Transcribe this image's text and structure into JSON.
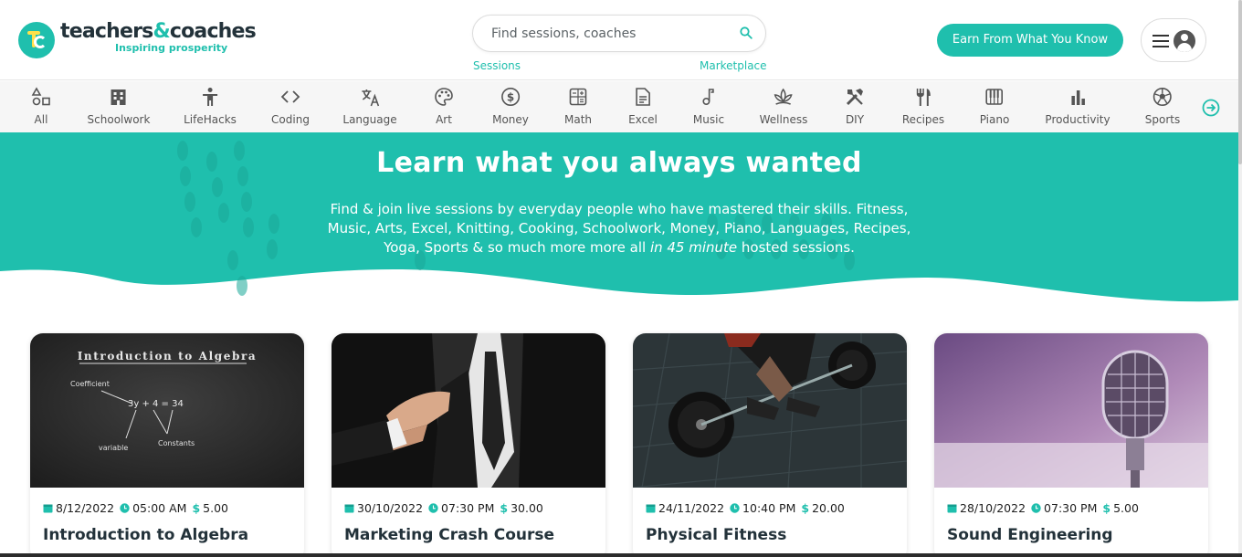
{
  "brand": {
    "name_part1": "teachers",
    "name_amp": "&",
    "name_part2": "coaches",
    "tagline": "Inspiring prosperity",
    "accent": "#1fbfad"
  },
  "search": {
    "placeholder": "Find sessions, coaches",
    "icon": "search-icon",
    "links": [
      "Sessions",
      "Marketplace"
    ]
  },
  "header": {
    "cta_label": "Earn From What You Know",
    "menu_icon": "hamburger-icon",
    "avatar_icon": "user-avatar-icon"
  },
  "categories": [
    {
      "label": "All",
      "icon": "shapes-icon"
    },
    {
      "label": "Schoolwork",
      "icon": "building-icon"
    },
    {
      "label": "LifeHacks",
      "icon": "person-icon"
    },
    {
      "label": "Coding",
      "icon": "code-icon"
    },
    {
      "label": "Language",
      "icon": "translate-icon"
    },
    {
      "label": "Art",
      "icon": "palette-icon"
    },
    {
      "label": "Money",
      "icon": "dollar-icon"
    },
    {
      "label": "Math",
      "icon": "calculator-icon"
    },
    {
      "label": "Excel",
      "icon": "document-icon"
    },
    {
      "label": "Music",
      "icon": "music-note-icon"
    },
    {
      "label": "Wellness",
      "icon": "lotus-icon"
    },
    {
      "label": "DIY",
      "icon": "tools-icon"
    },
    {
      "label": "Recipes",
      "icon": "utensils-icon"
    },
    {
      "label": "Piano",
      "icon": "piano-icon"
    },
    {
      "label": "Productivity",
      "icon": "bar-chart-icon"
    },
    {
      "label": "Sports",
      "icon": "soccer-ball-icon"
    }
  ],
  "hero": {
    "title": "Learn what you always wanted",
    "desc_main": "Find & join live sessions by everyday people who have mastered their skills. Fitness, Music, Arts, Excel, Knitting, Cooking, Schoolwork, Money, Piano, Languages, Recipes, Yoga, Sports & so much more more all ",
    "desc_em": "in 45 minute",
    "desc_tail": " hosted sessions."
  },
  "cards": [
    {
      "date": "8/12/2022",
      "time": "05:00 AM",
      "price": "5.00",
      "title": "Introduction to Algebra",
      "board": {
        "heading": "Introduction to Algebra",
        "coefficient": "Coefficient",
        "equation": "3y + 4  = 34",
        "variable": "variable",
        "constants": "Constants"
      }
    },
    {
      "date": "30/10/2022",
      "time": "07:30 PM",
      "price": "30.00",
      "title": "Marketing Crash Course"
    },
    {
      "date": "24/11/2022",
      "time": "10:40 PM",
      "price": "20.00",
      "title": "Physical Fitness"
    },
    {
      "date": "28/10/2022",
      "time": "07:30 PM",
      "price": "5.00",
      "title": "Sound Engineering"
    }
  ],
  "currency_symbol": "$"
}
